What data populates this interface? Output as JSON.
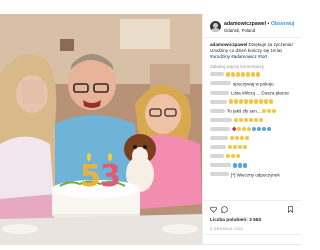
{
  "post": {
    "username": "adamowiczpawel",
    "separator": "•",
    "follow_label": "Obserwuj",
    "location": "Gdańsk, Poland",
    "caption_user": "adamowiczpawel",
    "caption_text": " Dziękuje za życzenia! Urodziny co dzień kończy się 18 lat ",
    "caption_tags": "#urodziny #adamowicz #tort",
    "load_more_label": "Załaduj więcej komentarzy",
    "likes_text": "Liczba polubień: 3 583",
    "date_text": "3 GRUDNIA 2018"
  },
  "comments": [
    {
      "text": "",
      "emoji": [
        "y",
        "y",
        "y",
        "y",
        "y",
        "y",
        "y"
      ]
    },
    {
      "text": "spoczywaj w pokoju",
      "emoji": []
    },
    {
      "text": "Lista Milczą ... Dusza płacze",
      "emoji": []
    },
    {
      "text": "",
      "emoji": [
        "y",
        "y",
        "y",
        "y",
        "y",
        "y",
        "y",
        "y",
        "y"
      ]
    },
    {
      "text": "To jakś zły sen....",
      "emoji": [
        "y",
        "y",
        "y"
      ]
    },
    {
      "text": "",
      "emoji": [
        "y",
        "y",
        "y",
        "y",
        "y",
        "y"
      ]
    },
    {
      "text": "",
      "emoji": [
        "h",
        "y",
        "y",
        "y",
        "b",
        "b",
        "b",
        "b"
      ]
    },
    {
      "text": "",
      "emoji": [
        "y",
        "y",
        "y",
        "y"
      ]
    },
    {
      "text": "",
      "emoji": [
        "y",
        "y",
        "y",
        "y"
      ]
    },
    {
      "text": "",
      "emoji": [
        "y",
        "y",
        "y"
      ]
    },
    {
      "text": "",
      "emoji": [
        "b",
        "b",
        "b"
      ]
    },
    {
      "text": "[*] Wieczny odpoczynek",
      "emoji": []
    }
  ],
  "colors": {
    "link": "#3897f0",
    "muted": "#999999",
    "text": "#262626"
  },
  "icons": [
    "heart-icon",
    "comment-icon",
    "bookmark-icon"
  ]
}
